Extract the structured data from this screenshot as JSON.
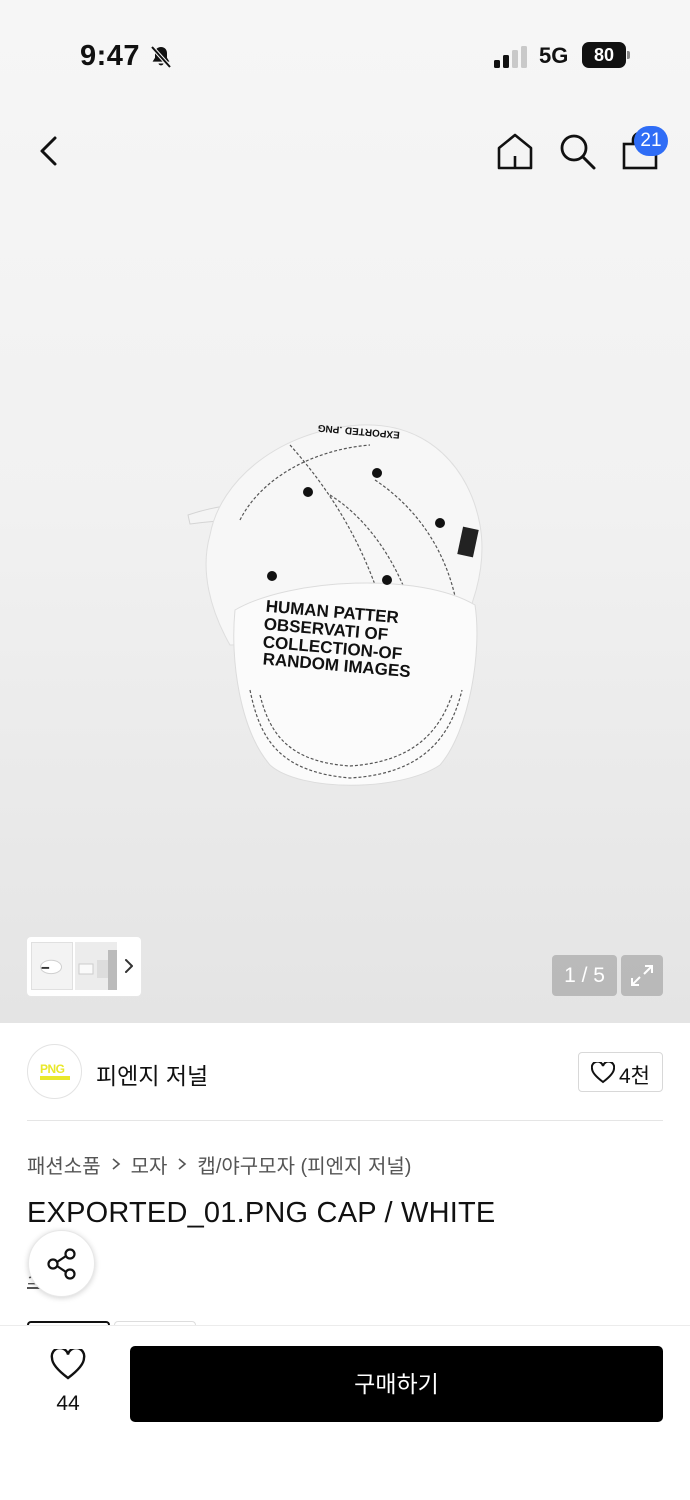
{
  "status_bar": {
    "time": "9:47",
    "network": "5G",
    "battery": "80"
  },
  "header": {
    "icons": [
      "chevron-left-icon",
      "home-icon",
      "search-icon",
      "shopping-bag-icon"
    ],
    "cart_badge": "21"
  },
  "gallery": {
    "counter": "1 / 5",
    "cap_text_lines": [
      "HUMAN PATTER",
      "OBSERVATI  OF",
      "COLLECTION-OF",
      "RANDOM IMAGES"
    ],
    "brim_text": "EXPORTED .PNG"
  },
  "brand": {
    "logo_text": "PNG",
    "name": "피엔지 저널",
    "like_count": "4천"
  },
  "breadcrumb": [
    "패션소품",
    "모자",
    "캡/야구모자 (피엔지 저널)"
  ],
  "product": {
    "title": "EXPORTED_01.PNG CAP / WHITE",
    "partial_link": "소개"
  },
  "bottom_bar": {
    "wish_count": "44",
    "buy_label": "구매하기"
  },
  "colors": {
    "badge": "#2f6df6",
    "buy_button": "#000000",
    "brand_logo": "#e9e82b"
  }
}
